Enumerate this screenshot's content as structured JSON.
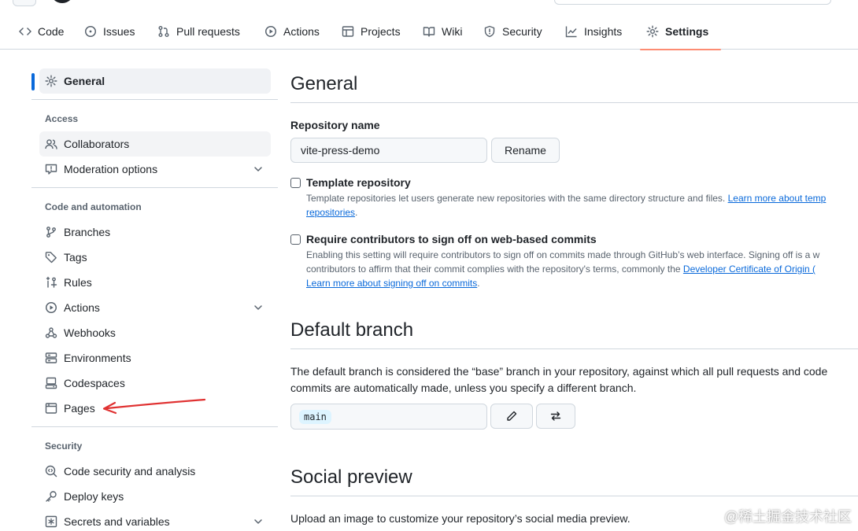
{
  "repo_nav": {
    "tabs": [
      {
        "label": "Code",
        "icon": "code-icon"
      },
      {
        "label": "Issues",
        "icon": "issue-icon"
      },
      {
        "label": "Pull requests",
        "icon": "pull-request-icon"
      },
      {
        "label": "Actions",
        "icon": "play-icon"
      },
      {
        "label": "Projects",
        "icon": "table-icon"
      },
      {
        "label": "Wiki",
        "icon": "book-icon"
      },
      {
        "label": "Security",
        "icon": "shield-icon"
      },
      {
        "label": "Insights",
        "icon": "graph-icon"
      },
      {
        "label": "Settings",
        "icon": "gear-icon",
        "active": true
      }
    ]
  },
  "sidebar": {
    "general": "General",
    "access_heading": "Access",
    "access": [
      "Collaborators",
      "Moderation options"
    ],
    "code_heading": "Code and automation",
    "code": [
      "Branches",
      "Tags",
      "Rules",
      "Actions",
      "Webhooks",
      "Environments",
      "Codespaces",
      "Pages"
    ],
    "security_heading": "Security",
    "security": [
      "Code security and analysis",
      "Deploy keys",
      "Secrets and variables"
    ]
  },
  "general": {
    "title": "General",
    "repo_name_label": "Repository name",
    "repo_name_value": "vite-press-demo",
    "rename_button": "Rename",
    "template": {
      "title": "Template repository",
      "note_line1": "Template repositories let users generate new repositories with the same directory structure and files.",
      "note_link1": "Learn more about temp",
      "note_link2": "repositories",
      "note_end": "."
    },
    "signoff": {
      "title": "Require contributors to sign off on web-based commits",
      "note_line1": "Enabling this setting will require contributors to sign off on commits made through GitHub’s web interface. Signing off is a w",
      "note_line2": "contributors to affirm that their commit complies with the repository's terms, commonly the",
      "note_link_dco": "Developer Certificate of Origin (",
      "note_link_more": "Learn more about signing off on commits",
      "note_end": "."
    }
  },
  "default_branch": {
    "title": "Default branch",
    "line1": "The default branch is considered the “base” branch in your repository, against which all pull requests and code",
    "line2": "commits are automatically made, unless you specify a different branch.",
    "branch": "main"
  },
  "social_preview": {
    "title": "Social preview",
    "line1": "Upload an image to customize your repository’s social media preview."
  },
  "watermark": "@稀土掘金技术社区",
  "colors": {
    "accent": "#0969da",
    "tab_underline": "#fd8c73",
    "arrow": "#e03131",
    "border": "#d0d7de"
  }
}
